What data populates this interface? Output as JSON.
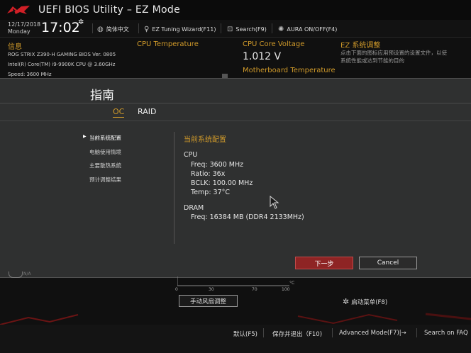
{
  "window": {
    "title": "UEFI BIOS Utility – EZ Mode"
  },
  "status": {
    "date": "12/17/2018",
    "weekday": "Monday",
    "time": "17:02",
    "tools": [
      {
        "icon": "globe-icon",
        "label": "简体中文"
      },
      {
        "icon": "lightbulb-icon",
        "label": "EZ Tuning Wizard(F11)"
      },
      {
        "icon": "search-icon",
        "label": "Search(F9)"
      },
      {
        "icon": "aura-icon",
        "label": "AURA ON/OFF(F4)"
      }
    ]
  },
  "info": {
    "title": "信息",
    "lines": [
      "ROG STRIX Z390-H GAMING    BIOS Ver. 0805",
      "Intel(R) Core(TM) i9-9900K CPU @ 3.60GHz",
      "Speed: 3600 MHz"
    ]
  },
  "cpu_temp": {
    "title": "CPU Temperature"
  },
  "cpu_voltage": {
    "title": "CPU Core Voltage",
    "value": "1.012 V",
    "mb_temp_title": "Motherboard Temperature"
  },
  "ez_system": {
    "title": "EZ 系统调整",
    "desc_1": "点击下面的图标应用预设置的设置文件，以使",
    "desc_2": "系统性能或达到节能的目的"
  },
  "dialog": {
    "title": "指南",
    "tabs": [
      {
        "label": "OC",
        "active": true
      },
      {
        "label": "RAID",
        "active": false
      }
    ],
    "menu": [
      "当前系统配置",
      "电脑使用情境",
      "主要散热系统",
      "预计调整结果"
    ],
    "config": {
      "title": "当前系统配置",
      "cpu_heading": "CPU",
      "cpu_lines": [
        "Freq: 3600 MHz",
        "Ratio: 36x",
        "BCLK: 100.00 MHz",
        "Temp: 37°C"
      ],
      "dram_heading": "DRAM",
      "dram_lines": [
        "Freq: 16384 MB (DDR4 2133MHz)"
      ]
    },
    "next_label": "下一步",
    "cancel_label": "Cancel"
  },
  "lower": {
    "na": "N/A",
    "axis_ticks": [
      "0",
      "30",
      "70",
      "100"
    ],
    "axis_unit": "°C",
    "fan_button": "手动风扇调整",
    "boot_menu": "启动菜单(F8)"
  },
  "bottom": {
    "items": [
      "默认(F5)",
      "保存并退出（F10)",
      "Advanced Mode(F7)|→",
      "Search on FAQ"
    ]
  },
  "colors": {
    "accent": "#d09a2a",
    "next_button": "#8e2424",
    "rog_red": "#b01c1c"
  }
}
